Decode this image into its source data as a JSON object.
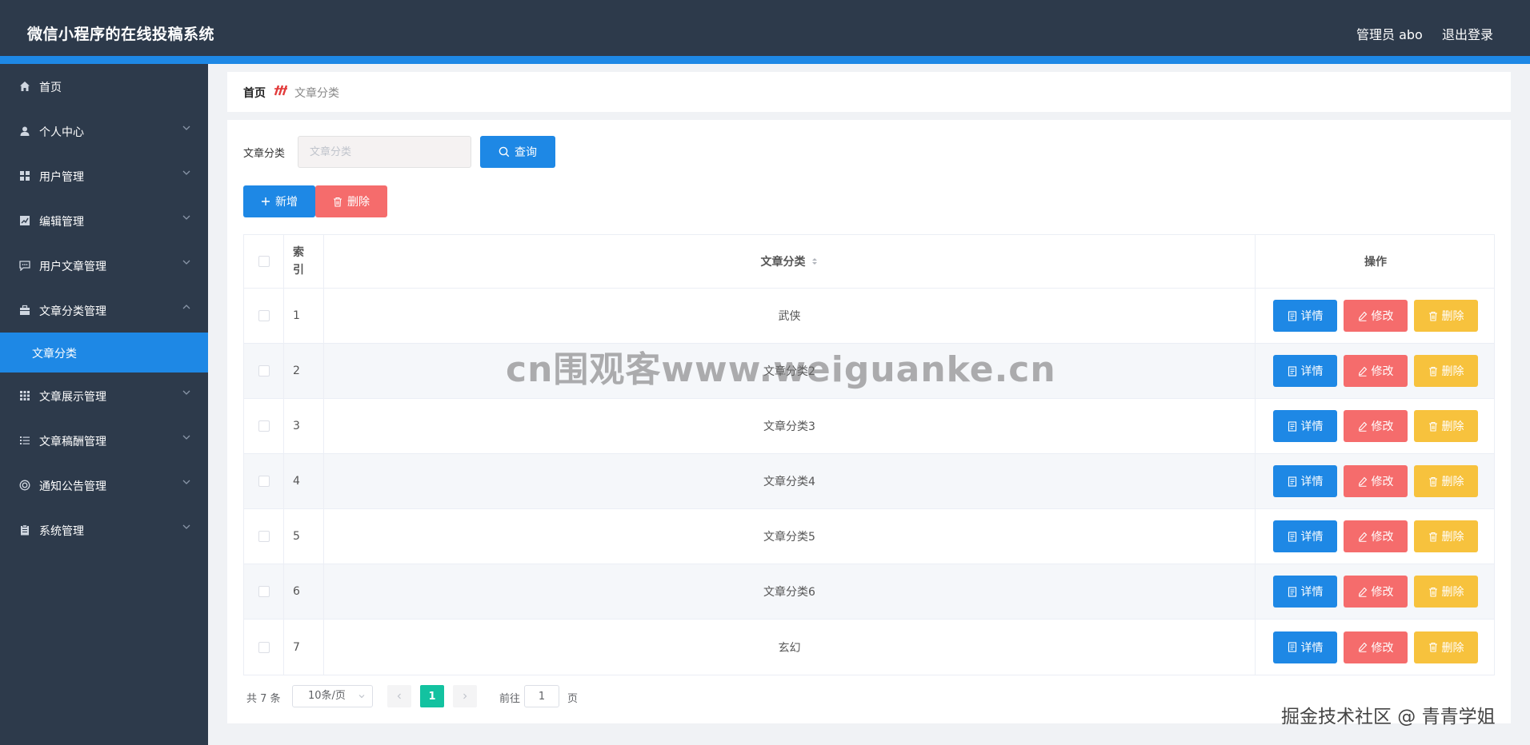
{
  "header": {
    "title": "微信小程序的在线投稿系统",
    "admin": "管理员 abo",
    "logout": "退出登录"
  },
  "sidebar": {
    "items": [
      {
        "label": "首页",
        "icon": "home-icon"
      },
      {
        "label": "个人中心",
        "icon": "user-icon"
      },
      {
        "label": "用户管理",
        "icon": "grid-icon"
      },
      {
        "label": "编辑管理",
        "icon": "chart-icon"
      },
      {
        "label": "用户文章管理",
        "icon": "chat-icon"
      },
      {
        "label": "文章分类管理",
        "icon": "briefcase-icon"
      },
      {
        "label": "文章展示管理",
        "icon": "apps-icon"
      },
      {
        "label": "文章稿酬管理",
        "icon": "list-icon"
      },
      {
        "label": "通知公告管理",
        "icon": "circle-icon"
      },
      {
        "label": "系统管理",
        "icon": "clipboard-icon"
      }
    ],
    "sub_item": "文章分类"
  },
  "breadcrumb": {
    "home": "首页",
    "current": "文章分类"
  },
  "search": {
    "label": "文章分类",
    "placeholder": "文章分类",
    "query_label": "查询"
  },
  "toolbar": {
    "add_label": "新增",
    "delete_label": "删除"
  },
  "table": {
    "headers": {
      "index": "索\n引",
      "name": "文章分类",
      "ops": "操作"
    },
    "rows": [
      {
        "index": "1",
        "name": "武侠"
      },
      {
        "index": "2",
        "name": "文章分类2"
      },
      {
        "index": "3",
        "name": "文章分类3"
      },
      {
        "index": "4",
        "name": "文章分类4"
      },
      {
        "index": "5",
        "name": "文章分类5"
      },
      {
        "index": "6",
        "name": "文章分类6"
      },
      {
        "index": "7",
        "name": "玄幻"
      }
    ],
    "op_labels": {
      "detail": "详情",
      "edit": "修改",
      "delete": "删除"
    }
  },
  "pager": {
    "total": "共 7 条",
    "page_size": "10条/页",
    "current_page": "1",
    "goto_label": "前往",
    "goto_value": "1",
    "page_unit": "页"
  },
  "watermark": "cn围观客www.weiguanke.cn",
  "corner_mark": "掘金技术社区 @ 青青学姐",
  "colors": {
    "header_bg": "#2d3a4b",
    "primary": "#1e88e5",
    "danger": "#f56c6c",
    "warning": "#f7c23d",
    "pager_active": "#13c2a0"
  }
}
